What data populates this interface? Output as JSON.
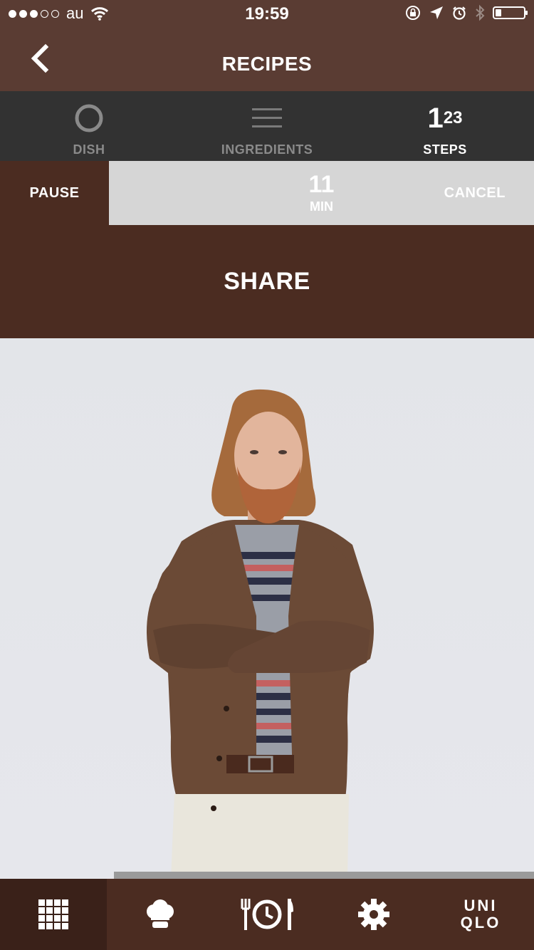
{
  "status_bar": {
    "carrier": "au",
    "time": "19:59",
    "signal_bars_filled": 3,
    "signal_bars_total": 5,
    "battery_level": 0.15
  },
  "nav": {
    "title": "RECIPES",
    "back_icon": "chevron-left-icon"
  },
  "tabs": [
    {
      "label": "DISH",
      "icon": "circle-icon",
      "active": false
    },
    {
      "label": "INGREDIENTS",
      "icon": "list-icon",
      "active": false
    },
    {
      "label": "STEPS",
      "icon": "numbered-steps-icon",
      "active": true,
      "icon_text_big": "1",
      "icon_text_small": "23"
    }
  ],
  "timer": {
    "pause_label": "PAUSE",
    "value": "11",
    "unit": "MIN",
    "cancel_label": "CANCEL"
  },
  "share": {
    "label": "SHARE"
  },
  "photo": {
    "subject": "man-in-cardigan-photo"
  },
  "tab_bar": {
    "items": [
      {
        "icon": "grid-icon",
        "active": true
      },
      {
        "icon": "chef-hat-icon",
        "active": false
      },
      {
        "icon": "fork-clock-knife-icon",
        "active": false
      },
      {
        "icon": "gear-icon",
        "active": false
      },
      {
        "icon": "uniqlo-logo",
        "active": false
      }
    ],
    "logo_line1": "UNI",
    "logo_line2": "QLO"
  },
  "colors": {
    "header_brown": "#5a3c33",
    "dark_brown": "#4b2c21",
    "tab_dark": "#323232",
    "timer_gray": "#d6d6d6"
  }
}
